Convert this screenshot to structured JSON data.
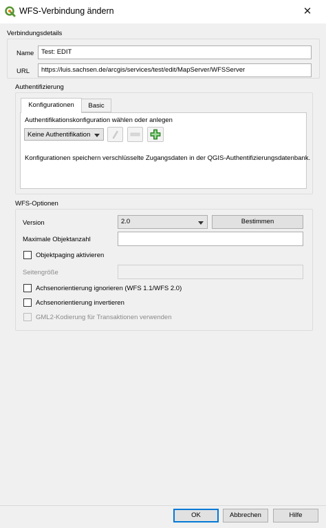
{
  "window": {
    "title": "WFS-Verbindung ändern",
    "close_glyph": "✕"
  },
  "connection": {
    "group_title": "Verbindungsdetails",
    "name_label": "Name",
    "name_value": "Test: EDIT",
    "url_label": "URL",
    "url_value": "https://luis.sachsen.de/arcgis/services/test/edit/MapServer/WFSServer"
  },
  "auth": {
    "group_title": "Authentifizierung",
    "tabs": [
      {
        "label": "Konfigurationen"
      },
      {
        "label": "Basic"
      }
    ],
    "choose_label": "Authentifikationskonfiguration wählen oder anlegen",
    "combo_value": "Keine Authentifikation",
    "icons": [
      "edit-pencil-icon",
      "remove-icon",
      "add-icon"
    ],
    "info_text": "Konfigurationen speichern verschlüsselte Zugangsdaten in der QGIS-Authentifizierungsdatenbank."
  },
  "wfs": {
    "group_title": "WFS-Optionen",
    "version_label": "Version",
    "version_value": "2.0",
    "detect_button": "Bestimmen",
    "max_features_label": "Maximale Objektanzahl",
    "max_features_value": "",
    "paging_label": "Objektpaging aktivieren",
    "page_size_label": "Seitengröße",
    "page_size_value": "",
    "ignore_axis_label": "Achsenorientierung ignorieren (WFS 1.1/WFS 2.0)",
    "invert_axis_label": "Achsenorientierung invertieren",
    "gml2_label": "GML2-Kodierung für Transaktionen verwenden"
  },
  "buttons": {
    "ok": "OK",
    "cancel": "Abbrechen",
    "help": "Hilfe"
  },
  "colors": {
    "qgis_green": "#589632",
    "qgis_yellow": "#ee7913",
    "add_green": "#3aa832",
    "focus_blue": "#0078d7"
  }
}
